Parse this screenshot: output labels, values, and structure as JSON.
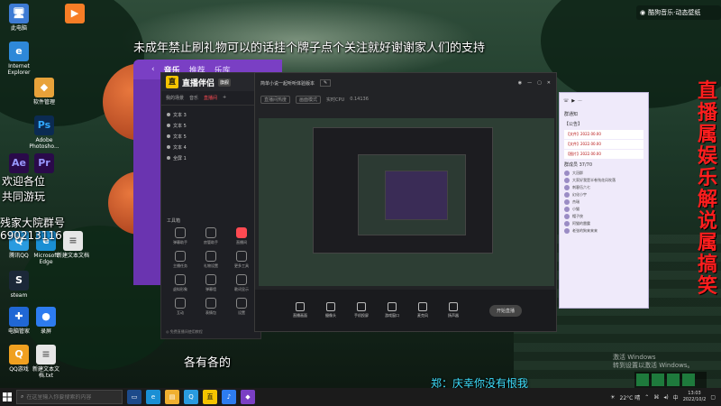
{
  "top_banner": "未成年禁止刷礼物可以的话挂个牌子点个关注就好谢谢家人们的支持",
  "welcome": "欢迎各位",
  "welcome2": "共同游玩",
  "group_line": "残家大院群号",
  "group_number": "690213116",
  "vertical_banner": [
    "直",
    "播",
    "属",
    "娱",
    "乐",
    "解",
    "说",
    "属",
    "搞",
    "笑"
  ],
  "subtitle_bottom": "各有各的",
  "subtitle_chat": "郑：庆幸你没有恨我",
  "watermark": "酷狗音乐·动态壁纸",
  "activate_windows": [
    "激活 Windows",
    "转到设置以激活 Windows。"
  ],
  "desktop_icons": [
    {
      "label": "此电脑",
      "glyph": "🖥",
      "color": "#3d7bd4"
    },
    {
      "label": "Internet Explorer",
      "glyph": "e",
      "color": "#2e88d8"
    },
    {
      "label": "软件管理",
      "glyph": "◆",
      "color": "#e8a23a"
    },
    {
      "label": "Adobe Photosho...",
      "glyph": "Ps",
      "color": "#0b2b52"
    },
    {
      "label": "Adobe After Effects",
      "glyph": "Ae",
      "color": "#2a0a4a"
    },
    {
      "label": "Premiere",
      "glyph": "Pr",
      "color": "#2a0a4a"
    },
    {
      "label": "腾讯QQ",
      "glyph": "Q",
      "color": "#2a9be0"
    },
    {
      "label": "steam",
      "glyph": "S",
      "color": "#1b2838"
    },
    {
      "label": "电脑管家",
      "glyph": "✚",
      "color": "#2067d4"
    },
    {
      "label": "QQ游戏",
      "glyph": "Q",
      "color": "#f0a020"
    },
    {
      "label": "Microsoft Edge",
      "glyph": "e",
      "color": "#1a8fd4"
    },
    {
      "label": "新建文本文档",
      "glyph": "≡",
      "color": "#e6e6e6"
    },
    {
      "label": "新建文本文档.txt",
      "glyph": "≡",
      "color": "#e6e6e6"
    },
    {
      "label": "腾讯视频",
      "glyph": "▶",
      "color": "#f77d26"
    },
    {
      "label": "录屏",
      "glyph": "●",
      "color": "#2d7cf0"
    }
  ],
  "music": {
    "title": "音乐",
    "tabs": [
      "推荐",
      "乐库",
      "歌手",
      "电台"
    ]
  },
  "broadcaster": {
    "title": "直播伴侣",
    "badge": "旗舰",
    "tabs": [
      "我的场景",
      "音乐",
      "直播间"
    ],
    "scenes": [
      "文本 3",
      "文本 5",
      "文本 5",
      "文本 4",
      "全屏 1"
    ],
    "toolbox_title": "工具箱",
    "tools": [
      "弹幕助手",
      "房管助手",
      "直播间",
      "主播任务",
      "礼物设置",
      "更多工具",
      "虚拟形象",
      "弹幕墙",
      "歌词显示",
      "互动",
      "表情包",
      "设置"
    ],
    "footer": "◎ 免费直播间使用教程"
  },
  "preview": {
    "title": "简单小说一起听听体验版本",
    "info": [
      "直播间热度",
      "画面模式",
      "实时CPU",
      "0.14136"
    ],
    "controls": [
      "直播画面",
      "摄像头",
      "手机投屏",
      "游戏窗口",
      "麦克风",
      "扬声器"
    ],
    "go_live": "开始直播"
  },
  "qq": {
    "notice": "群通知",
    "group_tag": "【公告】",
    "messages": [
      "【文件】2022.00.00",
      "【文件】2022.00.00",
      "【图片】2022.00.00"
    ],
    "members_title": "群成员 37/70",
    "members": [
      "大冠群",
      "大家好我是半卷残花风吹落",
      "刺客伍六七",
      "幻化小宇",
      "杰瑞",
      "小猫",
      "帽子侠",
      "阿猫的雷霆",
      "老张的狗来来来"
    ]
  },
  "taskbar": {
    "search_placeholder": "在这里输入你要搜索的内容",
    "temperature": "22°C 晴",
    "time": "13:03",
    "date": "2022/10/2"
  }
}
